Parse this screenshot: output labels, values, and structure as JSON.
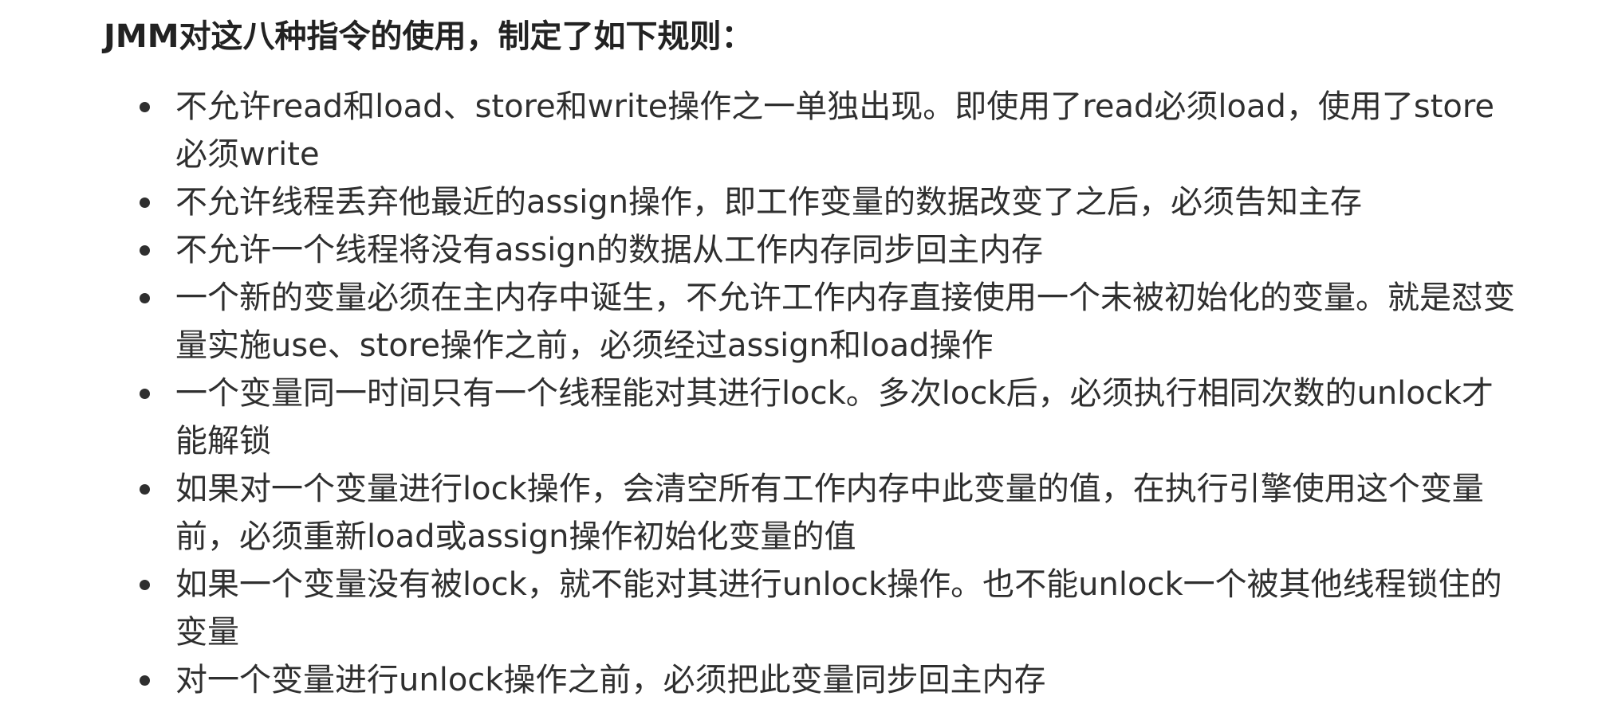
{
  "heading": "JMM对这八种指令的使用，制定了如下规则：",
  "rules": [
    "不允许read和load、store和write操作之一单独出现。即使用了read必须load，使用了store必须write",
    "不允许线程丢弃他最近的assign操作，即工作变量的数据改变了之后，必须告知主存",
    "不允许一个线程将没有assign的数据从工作内存同步回主内存",
    "一个新的变量必须在主内存中诞生，不允许工作内存直接使用一个未被初始化的变量。就是怼变量实施use、store操作之前，必须经过assign和load操作",
    "一个变量同一时间只有一个线程能对其进行lock。多次lock后，必须执行相同次数的unlock才能解锁",
    "如果对一个变量进行lock操作，会清空所有工作内存中此变量的值，在执行引擎使用这个变量前，必须重新load或assign操作初始化变量的值",
    "如果一个变量没有被lock，就不能对其进行unlock操作。也不能unlock一个被其他线程锁住的变量",
    "对一个变量进行unlock操作之前，必须把此变量同步回主内存"
  ]
}
